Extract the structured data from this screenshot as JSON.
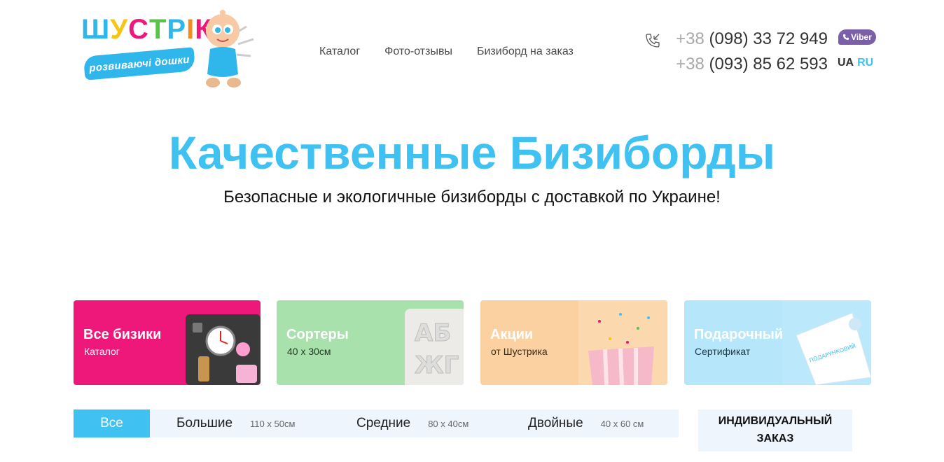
{
  "logo": {
    "word": [
      "Ш",
      "У",
      "С",
      "Т",
      "Р",
      "І",
      "К"
    ],
    "word_colors": [
      "#2fb6ea",
      "#f5c518",
      "#ee177a",
      "#5ac34a",
      "#2fb6ea",
      "#f58a1f",
      "#ee177a"
    ],
    "banner": "розвиваючі дошки"
  },
  "nav": {
    "items": [
      {
        "label": "Каталог"
      },
      {
        "label": "Фото-отзывы"
      },
      {
        "label": "Бизиборд на заказ"
      }
    ]
  },
  "contacts": {
    "phone1_prefix": "+38",
    "phone1_number": "(098) 33 72 949",
    "phone2_prefix": "+38",
    "phone2_number": "(093) 85 62 593",
    "viber_label": "Viber",
    "phone_icon": "phone-icon"
  },
  "lang": {
    "ua": "UA",
    "ru": "RU"
  },
  "hero": {
    "title": "Качественные Бизиборды",
    "subtitle": "Безопасные и экологичные бизиборды с доставкой по Украине!"
  },
  "cards": [
    {
      "title": "Все бизики",
      "subtitle": "Каталог",
      "color": "#ee177a"
    },
    {
      "title": "Сортеры",
      "subtitle": "40 х 30см",
      "color": "#a9e1ad"
    },
    {
      "title": "Акции",
      "subtitle": "от Шустрика",
      "color": "#fbd1a1"
    },
    {
      "title": "Подарочный",
      "subtitle": "Сертификат",
      "color": "#b6e6fa"
    }
  ],
  "filters": {
    "all": "Все",
    "items": [
      {
        "label": "Большие",
        "size": "110 x 50см"
      },
      {
        "label": "Средние",
        "size": "80 x 40см"
      },
      {
        "label": "Двойные",
        "size": "40 x 60 см"
      }
    ]
  },
  "custom_order": "ИНДИВИДУАЛЬНЫЙ ЗАКАЗ",
  "colors": {
    "accent": "#3fc2f1",
    "filter_bg": "#eef5fd"
  }
}
